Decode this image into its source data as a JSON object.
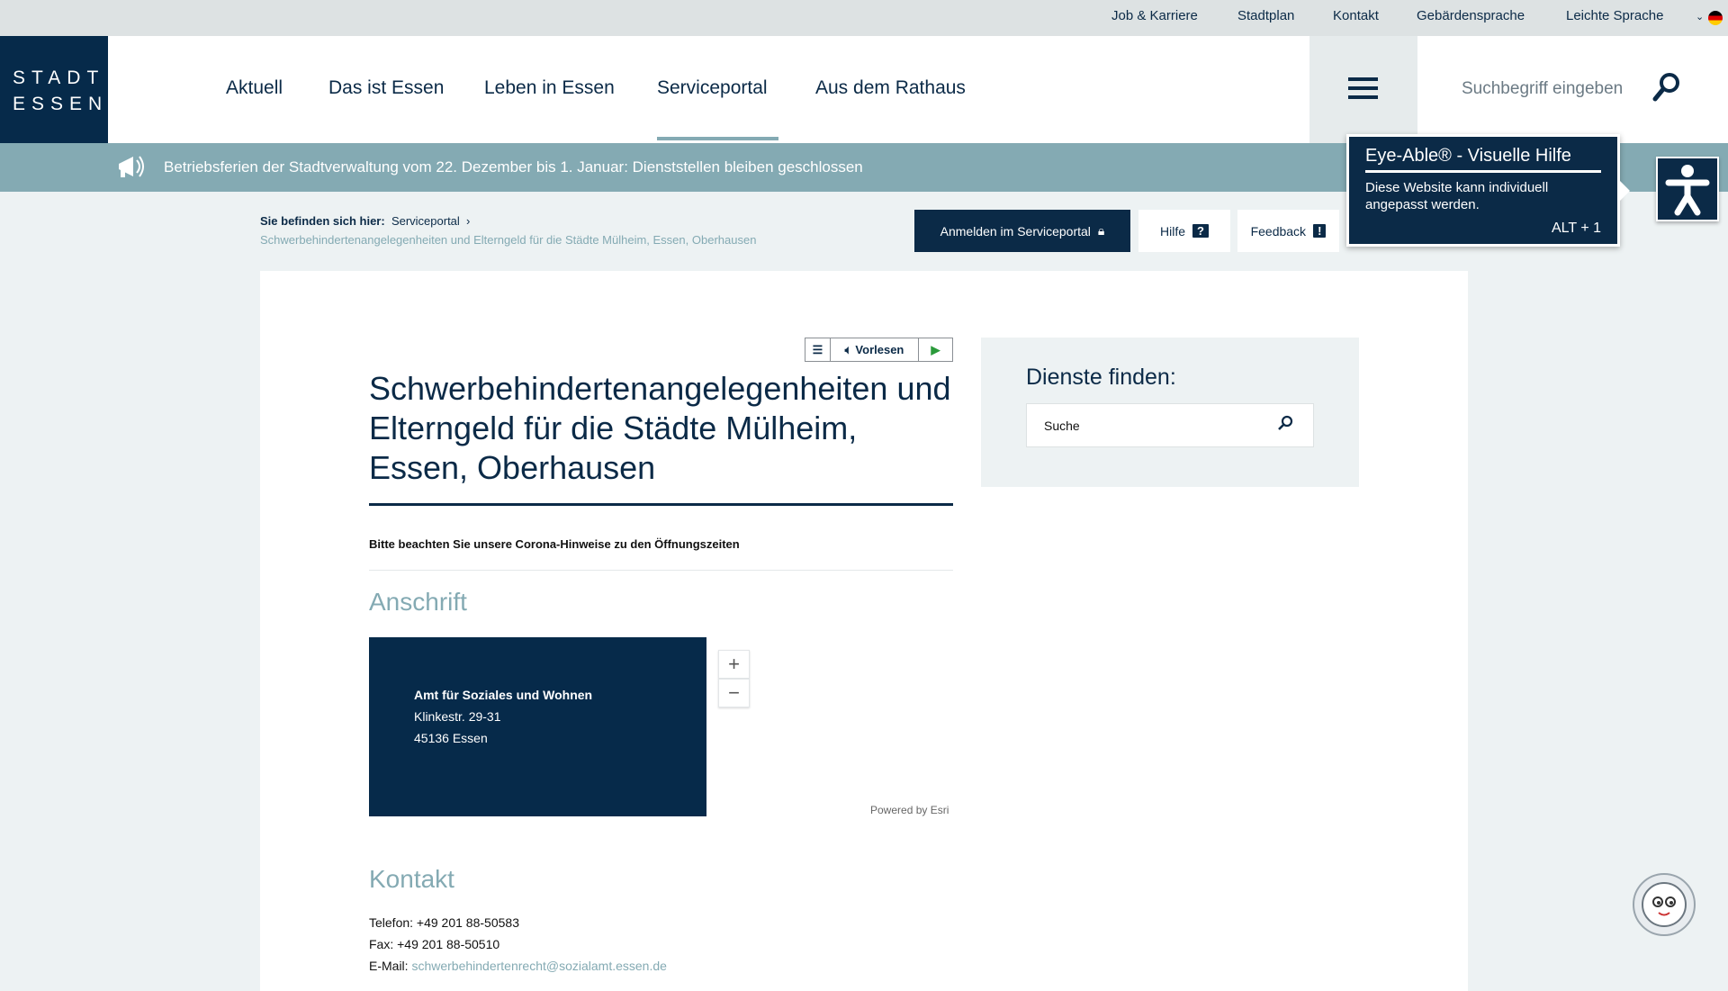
{
  "topbar": {
    "links": [
      "Job & Karriere",
      "Stadtplan",
      "Kontakt",
      "Gebärdensprache",
      "Leichte Sprache"
    ]
  },
  "logo": {
    "line1": "STADT",
    "line2": "ESSEN"
  },
  "nav": {
    "items": [
      "Aktuell",
      "Das ist Essen",
      "Leben in Essen",
      "Serviceportal",
      "Aus dem Rathaus"
    ],
    "active": "Serviceportal"
  },
  "search": {
    "placeholder": "Suchbegriff eingeben"
  },
  "banner": {
    "text": "Betriebsferien der Stadtverwaltung vom 22. Dezember bis 1. Januar: Dienststellen bleiben geschlossen"
  },
  "breadcrumb": {
    "label": "Sie befinden sich hier:",
    "parent": "Serviceportal",
    "current": "Schwerbehindertenangelegenheiten und Elterngeld für die Städte Mülheim, Essen, Oberhausen"
  },
  "buttons": {
    "login": "Anmelden im Serviceportal",
    "help": "Hilfe",
    "feedback": "Feedback"
  },
  "eyeable": {
    "title": "Eye-Able® - Visuelle Hilfe",
    "body": "Diese Website kann individuell angepasst werden.",
    "shortcut": "ALT + 1"
  },
  "readspeaker": {
    "label": "Vorlesen"
  },
  "main": {
    "title": "Schwerbehindertenangelegenheiten und Elterngeld für die Städte Mülheim, Essen, Oberhausen",
    "notice": "Bitte beachten Sie unsere Corona-Hinweise zu den Öffnungszeiten",
    "address_heading": "Anschrift",
    "address": {
      "name": "Amt für Soziales und Wohnen",
      "street": "Klinkestr. 29-31",
      "city": "45136 Essen"
    },
    "map_attribution": "Powered by Esri",
    "contact_heading": "Kontakt",
    "phone": "Telefon: +49 201 88-50583",
    "fax": "Fax: +49 201 88-50510",
    "email_label": "E-Mail: ",
    "email": "schwerbehindertenrecht@sozialamt.essen.de"
  },
  "sidebar": {
    "heading": "Dienste finden:",
    "search_placeholder": "Suche"
  },
  "colors": {
    "navy": "#062a4a",
    "accent": "#84aab3",
    "background": "#edf2f3"
  }
}
